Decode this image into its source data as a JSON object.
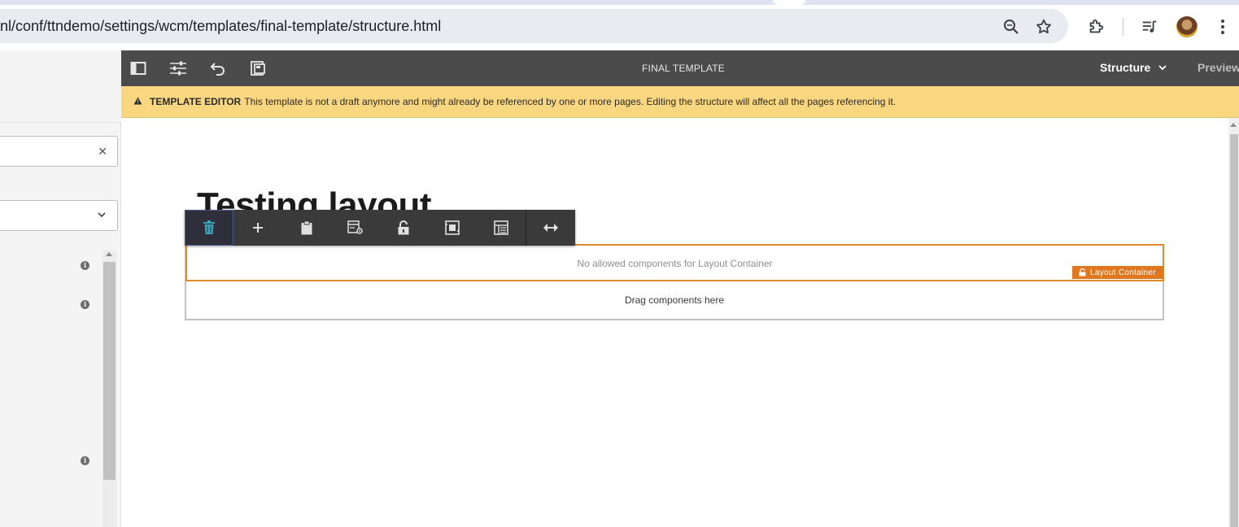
{
  "browser": {
    "url": "nl/conf/ttndemo/settings/wcm/templates/final-template/structure.html",
    "icons": [
      "zoom-icon",
      "bookmark-star-icon",
      "extensions-icon",
      "media-control-icon",
      "profile-avatar",
      "more-vert-icon"
    ]
  },
  "editor": {
    "title": "FINAL TEMPLATE",
    "mode_label": "Structure",
    "preview_label": "Preview",
    "toolbar_icons": [
      "side-panel-icon",
      "page-properties-icon",
      "undo-icon",
      "emulator-icon"
    ]
  },
  "alert": {
    "label": "TEMPLATE EDITOR",
    "message": "This template is not a draft anymore and might already be referenced by one or more pages. Editing the structure will affect all the pages referencing it."
  },
  "page": {
    "heading": "Testing layout"
  },
  "component_toolbar": {
    "actions": [
      "delete-icon",
      "insert-icon",
      "paste-icon",
      "policy-icon",
      "unlock-icon",
      "parent-icon",
      "group-icon",
      "layout-icon"
    ]
  },
  "container": {
    "empty_message": "No allowed components for Layout Container",
    "tag_label": "Layout Container",
    "drop_message": "Drag components here"
  },
  "colors": {
    "editor_bar": "#4b4b4b",
    "alert_bg": "#f9d680",
    "container_accent": "#e0771f",
    "active_tool": "#3aa3b8"
  }
}
